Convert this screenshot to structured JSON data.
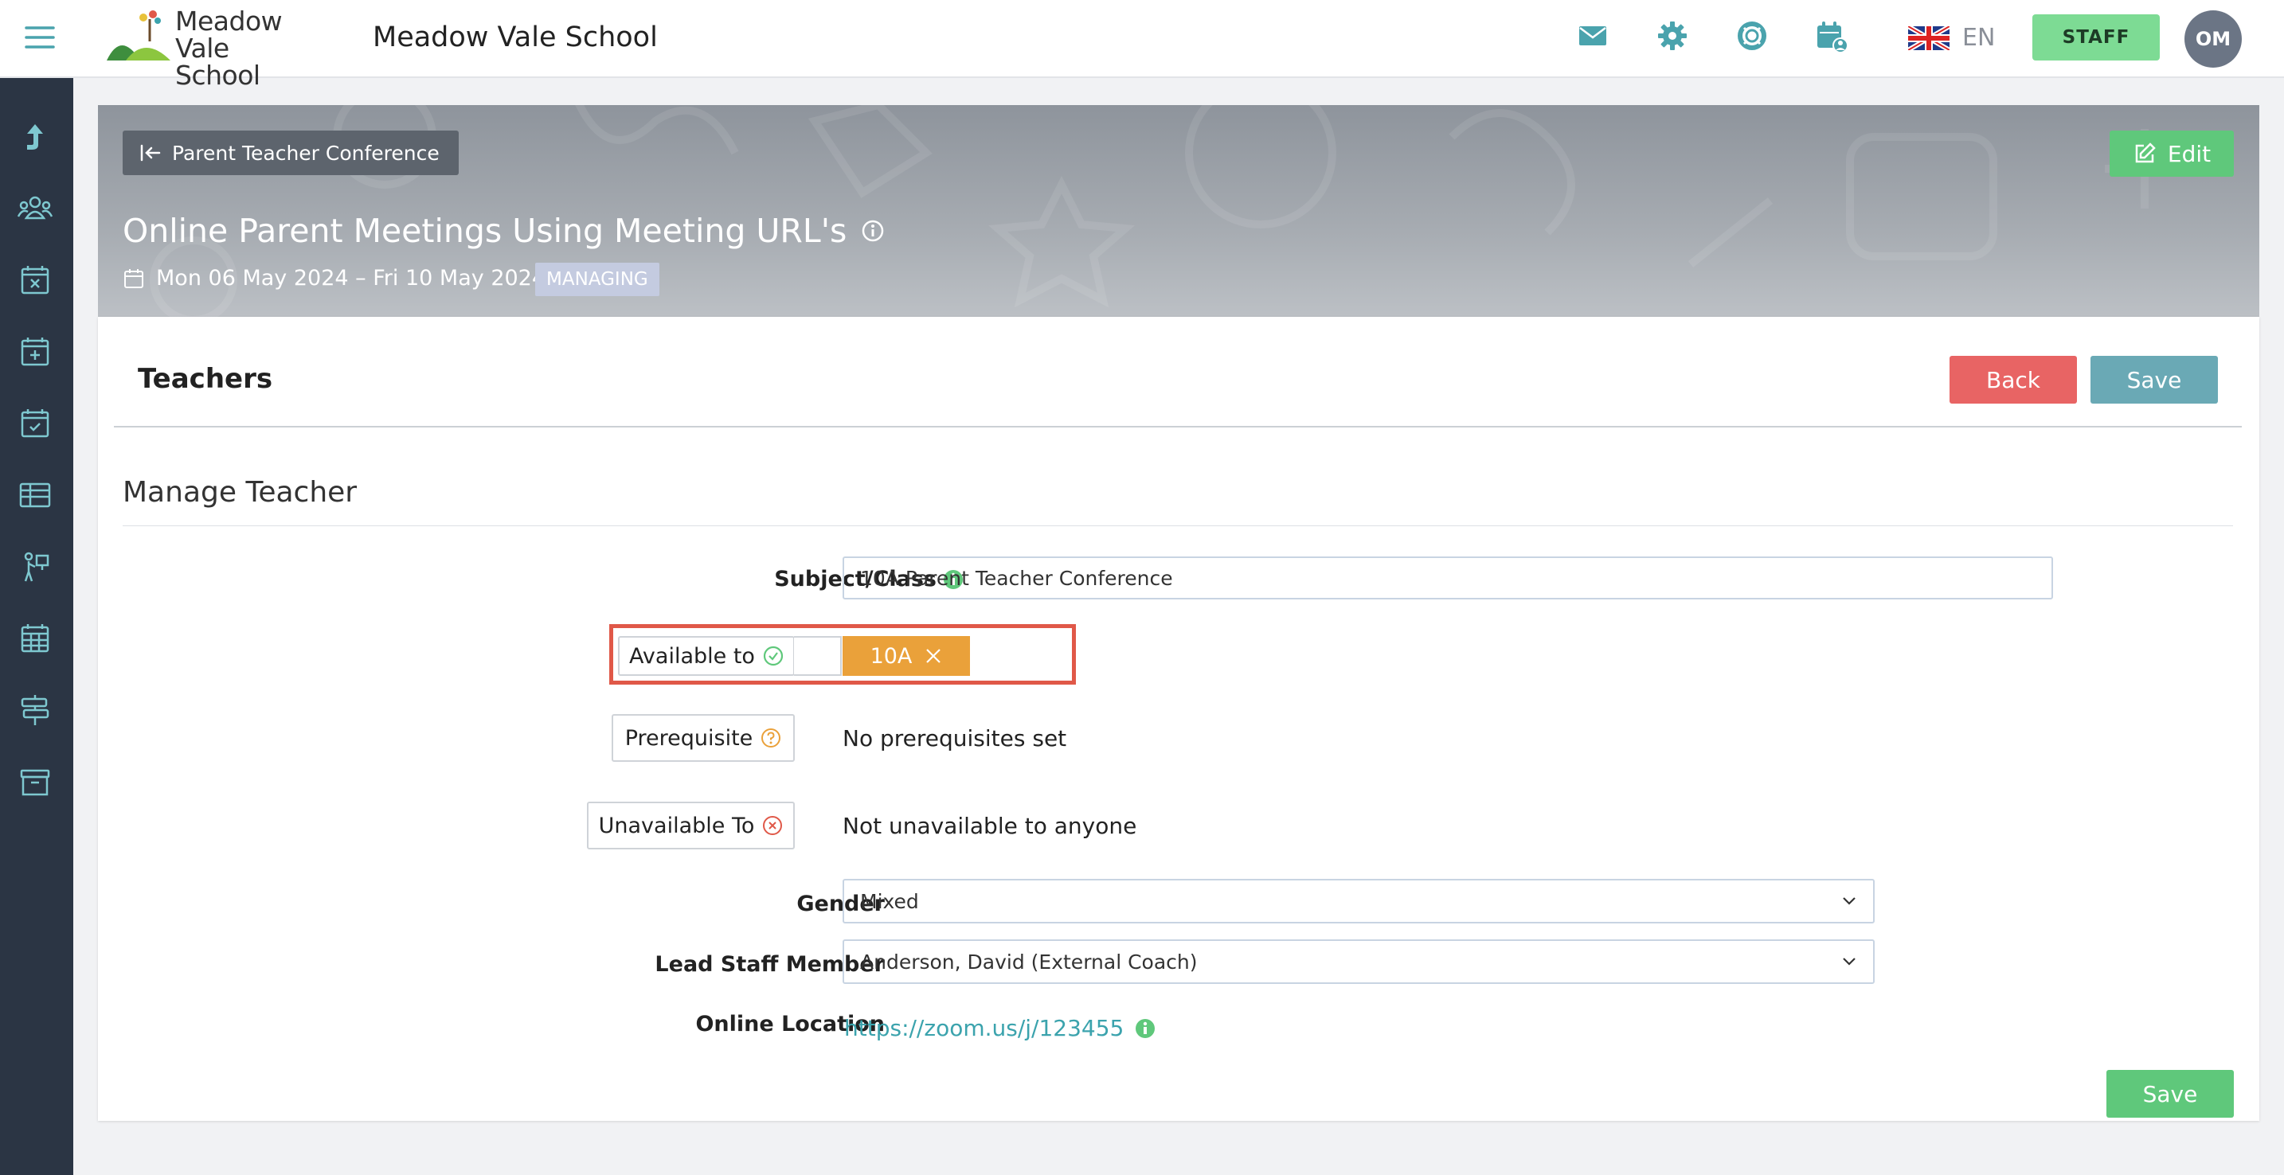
{
  "header": {
    "logo_line1": "Meadow",
    "logo_line2": "Vale School",
    "school_name": "Meadow Vale School",
    "language": "EN",
    "staff_label": "STAFF",
    "avatar_initials": "OM",
    "icons": [
      "menu-icon",
      "mail-icon",
      "gear-icon",
      "lifebuoy-icon",
      "calendar-user-icon",
      "uk-flag-icon"
    ]
  },
  "sidebar": {
    "items": [
      "arrow-up-icon",
      "people-icon",
      "calendar-x-icon",
      "calendar-plus-icon",
      "calendar-check-icon",
      "table-icon",
      "presenter-icon",
      "calendar-grid-icon",
      "signpost-icon",
      "archive-icon"
    ]
  },
  "banner": {
    "back_label": "Parent Teacher Conference",
    "edit_label": "Edit",
    "title": "Online Parent Meetings Using Meeting URL's",
    "dates": "Mon 06 May 2024 – Fri 10 May 2024",
    "status_badge": "MANAGING"
  },
  "page": {
    "section_title": "Teachers",
    "back_button": "Back",
    "save_button": "Save",
    "manage_title": "Manage Teacher",
    "bottom_save_button": "Save"
  },
  "form": {
    "subject_label": "Subject/Class",
    "subject_value": "10A Parent Teacher Conference",
    "available_label": "Available to",
    "available_tag": "10A",
    "prerequisite_label": "Prerequisite",
    "prerequisite_value": "No prerequisites set",
    "unavailable_label": "Unavailable To",
    "unavailable_value": "Not unavailable to anyone",
    "gender_label": "Gender",
    "gender_value": "Mixed",
    "lead_staff_label": "Lead Staff Member",
    "lead_staff_value": "Anderson, David (External Coach)",
    "online_location_label": "Online Location",
    "online_location_value": "https://zoom.us/j/123455"
  },
  "colors": {
    "sidebar": "#2b3544",
    "accent_teal": "#3ba3ad",
    "staff_green": "#7ddb94",
    "edit_green": "#5fc87b",
    "back_red": "#e86464",
    "save_teal": "#6aa9b5",
    "tag_orange": "#eaa13a",
    "highlight": "#e05848"
  }
}
